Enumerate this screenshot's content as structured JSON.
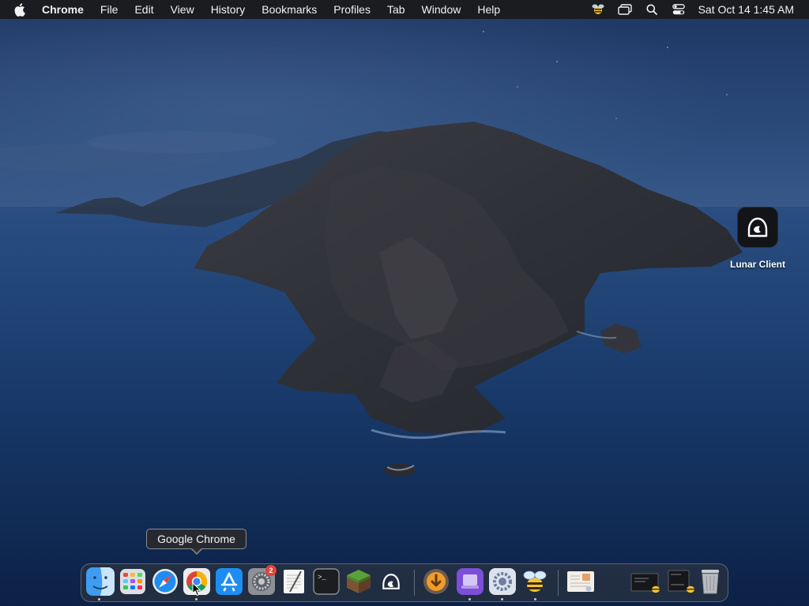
{
  "menubar": {
    "app_name": "Chrome",
    "menus": [
      "File",
      "Edit",
      "View",
      "History",
      "Bookmarks",
      "Profiles",
      "Tab",
      "Window",
      "Help"
    ],
    "clock": "Sat Oct 14  1:45 AM"
  },
  "desktop": {
    "items": [
      {
        "label": "Lunar Client",
        "icon": "lunar-client-icon"
      }
    ]
  },
  "tooltip": {
    "text": "Google Chrome"
  },
  "dock": {
    "items": [
      {
        "name": "finder",
        "icon": "finder-icon",
        "running": true
      },
      {
        "name": "launchpad",
        "icon": "launchpad-icon",
        "running": false
      },
      {
        "name": "safari",
        "icon": "safari-icon",
        "running": false
      },
      {
        "name": "google-chrome",
        "icon": "chrome-icon",
        "running": true
      },
      {
        "name": "app-store",
        "icon": "app-store-icon",
        "running": false
      },
      {
        "name": "system-preferences",
        "icon": "gear-icon",
        "running": false,
        "badge": "2"
      },
      {
        "name": "textedit",
        "icon": "textedit-icon",
        "running": false
      },
      {
        "name": "terminal",
        "icon": "terminal-icon",
        "running": false
      },
      {
        "name": "minecraft",
        "icon": "grass-block-icon",
        "running": false
      },
      {
        "name": "lunar-client",
        "icon": "lunar-client-icon",
        "running": false
      },
      {
        "name": "downloader",
        "icon": "download-icon",
        "running": false
      },
      {
        "name": "disk-app",
        "icon": "purple-disk-icon",
        "running": true
      },
      {
        "name": "utility-app",
        "icon": "gear-icon",
        "running": true
      },
      {
        "name": "bee-app",
        "icon": "bee-icon",
        "running": true
      },
      {
        "name": "preview-document",
        "icon": "document-icon",
        "running": false
      },
      {
        "name": "minimized-window-1",
        "icon": "window-thumbnail-icon",
        "running": false
      },
      {
        "name": "minimized-window-2",
        "icon": "window-thumbnail-icon",
        "running": false
      },
      {
        "name": "trash",
        "icon": "trash-icon",
        "running": false
      }
    ],
    "terminal_prompt": ">_"
  },
  "colors": {
    "menubar_bg": "#1a1c20",
    "badge": "#e8413a",
    "sea": "#15305a"
  }
}
